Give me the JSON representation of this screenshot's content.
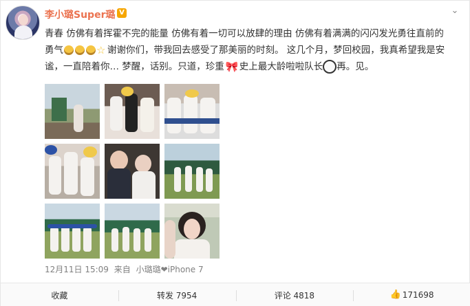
{
  "post": {
    "username": "李小璐Super璐",
    "verified_badge": "V",
    "line1": "青春 仿佛有着挥霍不完的能量 仿佛有着一切可以放肆的理由 仿佛有着满满的闪闪发光勇往直前的",
    "line2_prefix": "勇气",
    "line2_suffix": "谢谢你们，带我回去感受了那美丽的时刻。 这几个月，梦回校园，我真希望我是安",
    "line3_prefix": "谧，一直陪着你… 梦醒，话别。只道，珍重",
    "line3_middle": "史上最大龄啦啦队长",
    "line3_suffix": "再。见。",
    "timestamp": "12月11日 15:09",
    "source_prefix": "来自",
    "source": "小璐璐❤iPhone 7"
  },
  "icons": {
    "more": "chevron-down-icon",
    "like": "thumb-up-icon",
    "emoji1": "sun-face-emoji",
    "emoji2": "star-emoji",
    "emoji3": "bow-emoji",
    "emoji4": "panda-face-emoji"
  },
  "actions": {
    "favorite": "收藏",
    "repost": "转发 7954",
    "comment": "评论 4818",
    "like": "171698"
  },
  "colors": {
    "username": "#eb7350",
    "verified": "#f6a600",
    "text": "#333333",
    "meta": "#808080"
  }
}
